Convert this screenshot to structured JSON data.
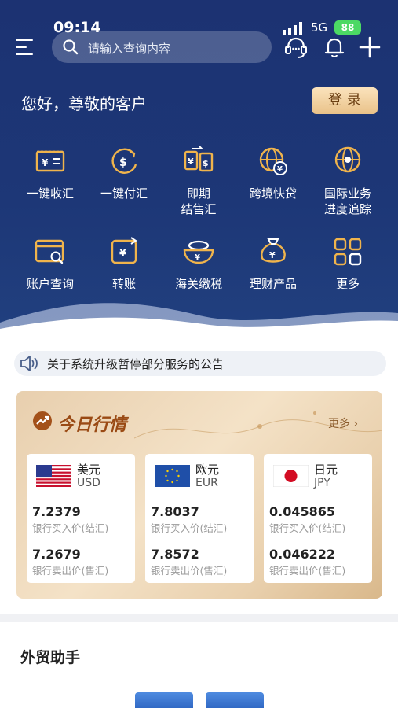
{
  "status": {
    "time": "09:14",
    "network": "5G",
    "battery": "88"
  },
  "search": {
    "placeholder": "请输入查询内容"
  },
  "greeting": "您好，尊敬的客户",
  "login_label": "登录",
  "functions": [
    {
      "label": "一键收汇",
      "icon": "receive-remittance-icon"
    },
    {
      "label": "一键付汇",
      "icon": "pay-remittance-icon"
    },
    {
      "label": "即期\n结售汇",
      "label_lines": [
        "即期",
        "结售汇"
      ],
      "icon": "spot-exchange-icon"
    },
    {
      "label": "跨境快贷",
      "icon": "cross-border-loan-icon"
    },
    {
      "label": "国际业务\n进度追踪",
      "label_lines": [
        "国际业务",
        "进度追踪"
      ],
      "icon": "progress-tracking-icon"
    },
    {
      "label": "账户查询",
      "icon": "account-query-icon"
    },
    {
      "label": "转账",
      "icon": "transfer-icon"
    },
    {
      "label": "海关缴税",
      "icon": "customs-tax-icon"
    },
    {
      "label": "理财产品",
      "icon": "wealth-product-icon"
    },
    {
      "label": "更多",
      "icon": "grid-more-icon"
    }
  ],
  "notice": "关于系统升级暂停部分服务的公告",
  "market": {
    "title": "今日行情",
    "more_label": "更多",
    "currencies": [
      {
        "name": "美元",
        "code": "USD",
        "buy": "7.2379",
        "buy_label": "银行买入价(结汇)",
        "sell": "7.2679",
        "sell_label": "银行卖出价(售汇)"
      },
      {
        "name": "欧元",
        "code": "EUR",
        "buy": "7.8037",
        "buy_label": "银行买入价(结汇)",
        "sell": "7.8572",
        "sell_label": "银行卖出价(售汇)"
      },
      {
        "name": "日元",
        "code": "JPY",
        "buy": "0.045865",
        "buy_label": "银行买入价(结汇)",
        "sell": "0.046222",
        "sell_label": "银行卖出价(售汇)"
      }
    ]
  },
  "section_title": "外贸助手",
  "colors": {
    "primary": "#1c3272",
    "gold": "#f0b44c",
    "accent_text": "#9a4a14"
  }
}
